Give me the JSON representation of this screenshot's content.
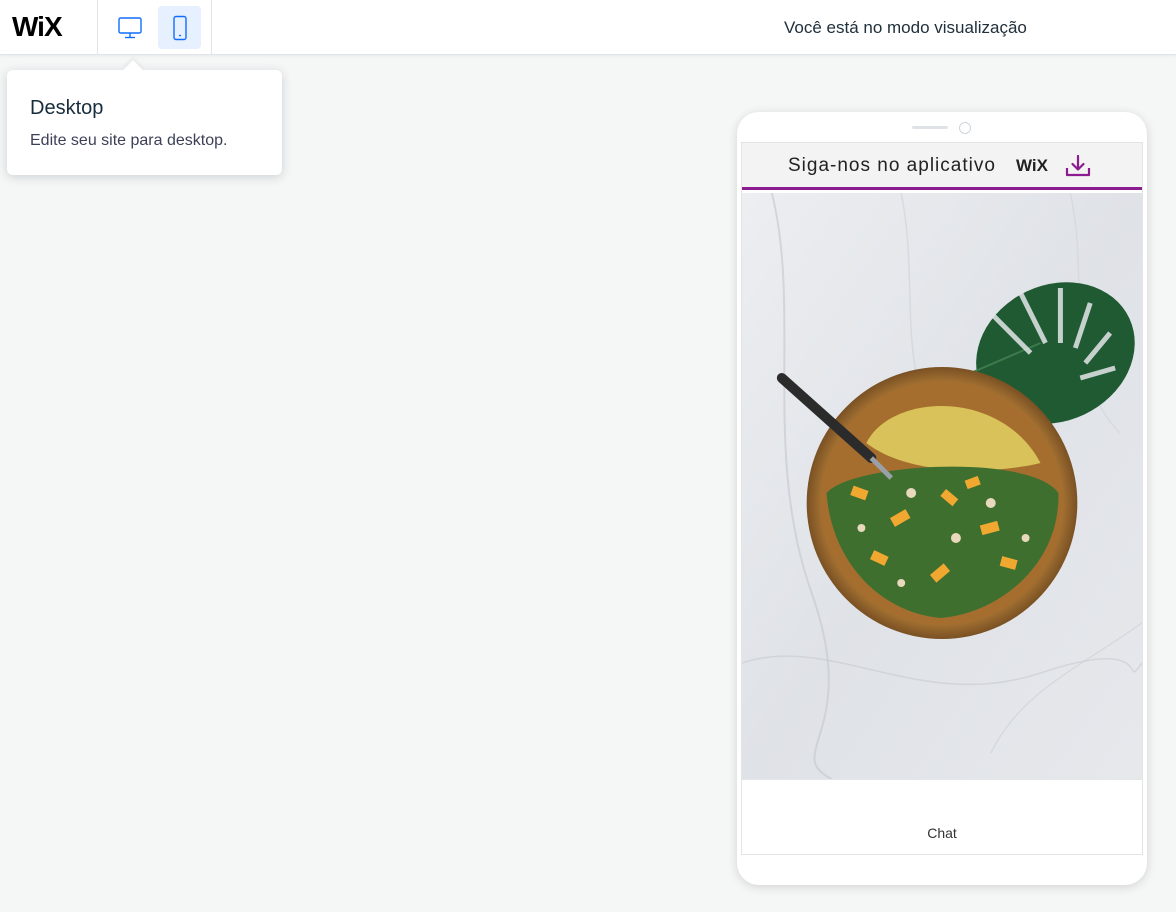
{
  "topbar": {
    "logo": "WiX",
    "preview_message": "Você está no modo visualização",
    "desktop_button_icon": "desktop-monitor-icon",
    "mobile_button_icon": "mobile-phone-icon",
    "active_device": "mobile"
  },
  "tooltip": {
    "title": "Desktop",
    "description": "Edite seu site para desktop."
  },
  "phone": {
    "banner_text": "Siga-nos no aplicativo",
    "banner_logo": "WiX",
    "banner_icon": "download-icon",
    "banner_accent": "#8b1b8e",
    "hero_image": "salad-bowl-on-marble-with-monstera-leaf",
    "chat_label": "Chat"
  },
  "colors": {
    "accent": "#116dff",
    "active_bg": "#e7f0ff",
    "canvas_bg": "#f5f6f6"
  }
}
